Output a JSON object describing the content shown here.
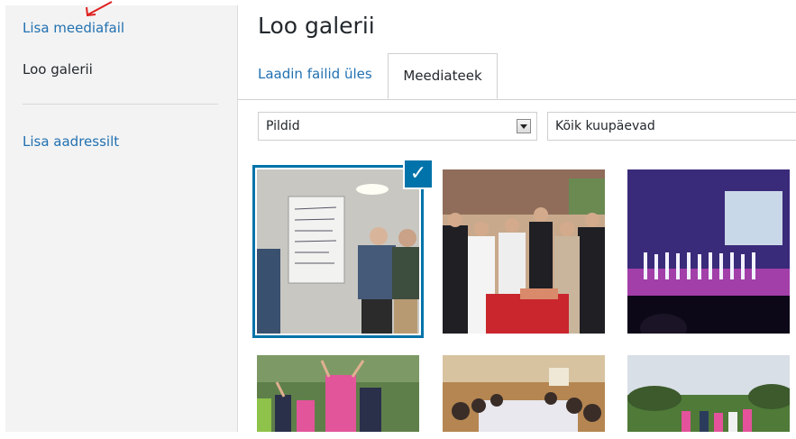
{
  "sidebar": {
    "add_media": "Lisa meediafail",
    "create_gallery": "Loo galerii",
    "insert_url": "Lisa aadressilt"
  },
  "main": {
    "title": "Loo galerii",
    "tabs": [
      {
        "label": "Laadin failid üles",
        "active": false
      },
      {
        "label": "Meediateek",
        "active": true
      }
    ],
    "filters": {
      "type": "Pildid",
      "date": "Kõik kuupäevad"
    }
  },
  "media": [
    {
      "subject": "classroom flipchart boys",
      "selected": true
    },
    {
      "subject": "students at cake table",
      "selected": false
    },
    {
      "subject": "dance stage performance",
      "selected": false
    },
    {
      "subject": "jumping group in forest",
      "selected": false
    },
    {
      "subject": "dining hall group",
      "selected": false
    },
    {
      "subject": "outdoor field group",
      "selected": false
    }
  ],
  "colors": {
    "accent": "#0073aa",
    "link": "#2271b1"
  }
}
